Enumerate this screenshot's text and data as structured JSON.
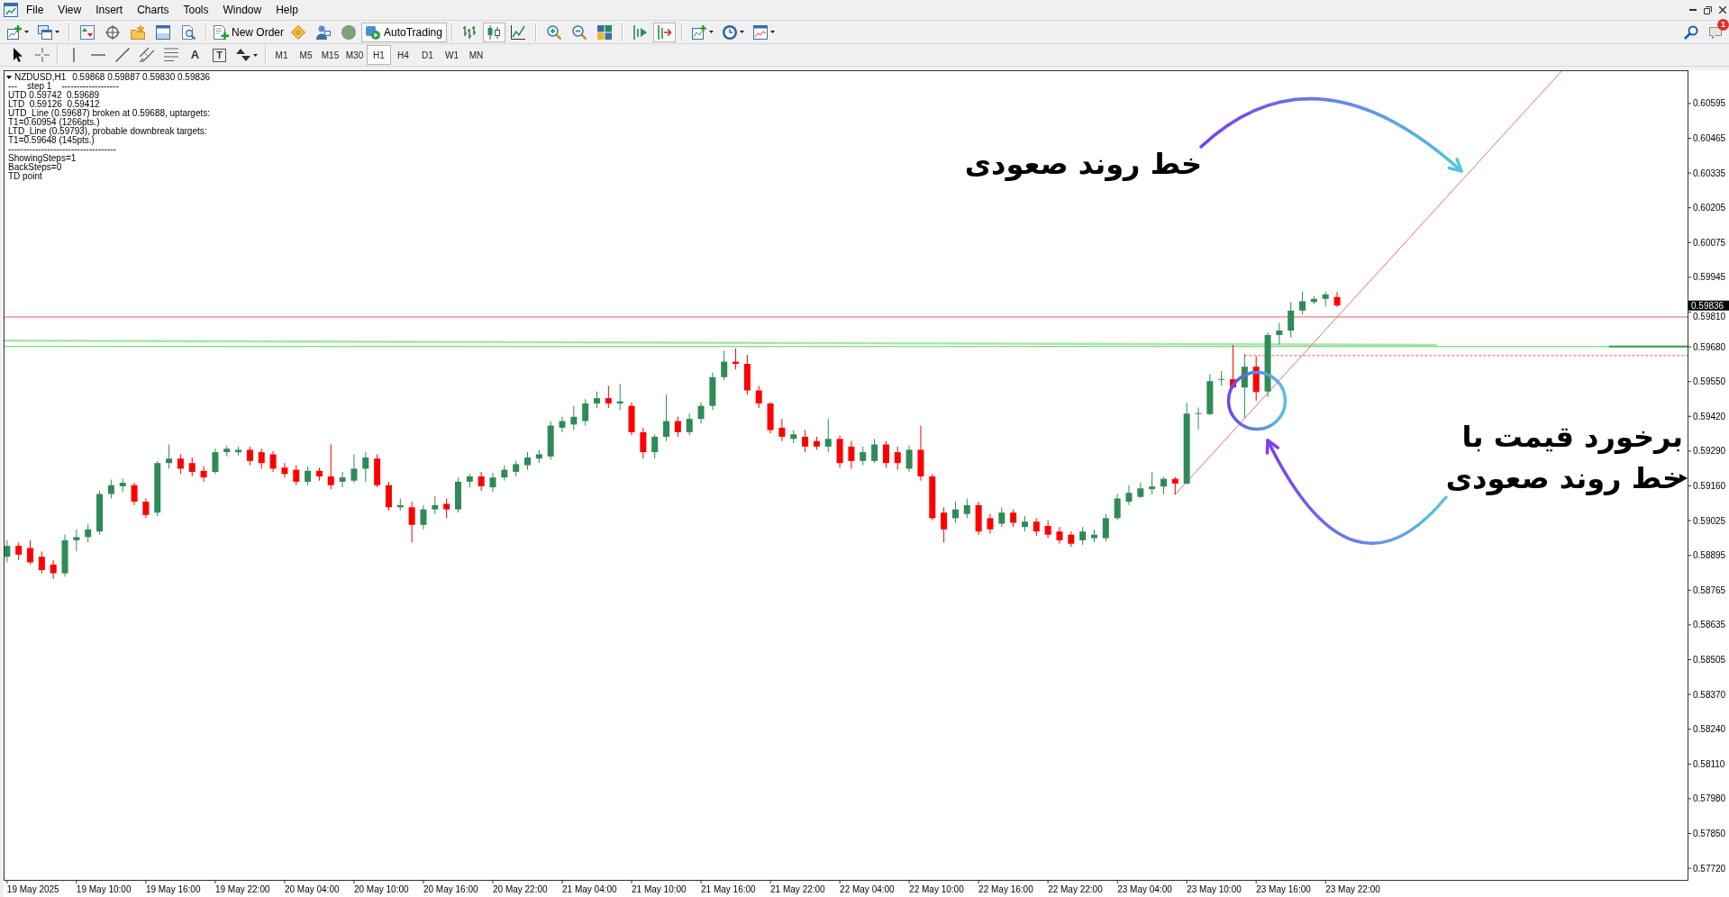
{
  "menu": [
    "File",
    "View",
    "Insert",
    "Charts",
    "Tools",
    "Window",
    "Help"
  ],
  "toolbar": {
    "new_order": "New Order",
    "auto_trading": {
      "label": "AutoTrading",
      "on": true
    },
    "chart_types": [
      {
        "kind": "bars",
        "selected": false
      },
      {
        "kind": "candles",
        "selected": true
      },
      {
        "kind": "line",
        "selected": false
      }
    ],
    "chart_shift": {
      "on": false
    },
    "auto_scroll": {
      "on": true
    },
    "text_tool": "A",
    "label_tool": "T"
  },
  "timeframes": [
    {
      "label": "M1",
      "selected": false
    },
    {
      "label": "M5",
      "selected": false
    },
    {
      "label": "M15",
      "selected": false
    },
    {
      "label": "M30",
      "selected": false
    },
    {
      "label": "H1",
      "selected": true
    },
    {
      "label": "H4",
      "selected": false
    },
    {
      "label": "D1",
      "selected": false
    },
    {
      "label": "W1",
      "selected": false
    },
    {
      "label": "MN",
      "selected": false
    }
  ],
  "notifications": {
    "badge": "1"
  },
  "chart": {
    "comment": {
      "symbol": "NZDUSD,H1",
      "ohlc": "0.59868 0.59887 0.59830 0.59836",
      "lines": [
        "---    step 1    -------------------",
        "UTD 0.59742  0.59689",
        "LTD  0.59126  0.59412",
        "UTD_Line (0.59687) broken at 0.59688, uptargets:",
        "T1=0.60954 (1266pts.)",
        "LTD_Line (0.59793), probable downbreak targets:",
        "T1=0.59648 (145pts.)",
        "------------------------------------",
        "ShowingSteps=1",
        "BackSteps=0",
        "TD point"
      ]
    },
    "price_labels": [
      "0.60595",
      "0.60465",
      "0.60335",
      "0.60205",
      "0.60075",
      "0.59945",
      "0.59810",
      "0.59680",
      "0.59550",
      "0.59420",
      "0.59290",
      "0.59160",
      "0.59025",
      "0.58895",
      "0.58765",
      "0.58635",
      "0.58505",
      "0.58370",
      "0.58240",
      "0.58110",
      "0.57980",
      "0.57850",
      "0.57720"
    ],
    "time_labels": [
      "19 May 2025",
      "19 May 10:00",
      "19 May 16:00",
      "19 May 22:00",
      "20 May 04:00",
      "20 May 10:00",
      "20 May 16:00",
      "20 May 22:00",
      "21 May 04:00",
      "21 May 10:00",
      "21 May 16:00",
      "21 May 22:00",
      "22 May 04:00",
      "22 May 10:00",
      "22 May 16:00",
      "22 May 22:00",
      "23 May 04:00",
      "23 May 10:00",
      "23 May 16:00",
      "23 May 22:00"
    ],
    "price_tag": "0.59836"
  },
  "callouts": [
    {
      "text": "خط روند صعودی"
    },
    {
      "text": "برخورد قیمت با خط روند صعودی"
    }
  ]
}
